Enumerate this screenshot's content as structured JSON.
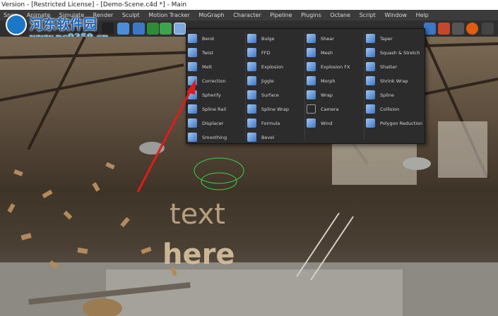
{
  "window": {
    "title": "Version - [Restricted License] - [Demo-Scene.c4d *] - Main"
  },
  "menubar": {
    "items": [
      "Snap",
      "Animate",
      "Simulate",
      "Render",
      "Sculpt",
      "Motion Tracker",
      "MoGraph",
      "Character",
      "Pipeline",
      "Plugins",
      "Octane",
      "Script",
      "Window",
      "Help"
    ]
  },
  "watermark": {
    "title": "河东软件园",
    "url": "www.pc0359.cn"
  },
  "scene_text": {
    "line1": "text",
    "line2": "here"
  },
  "deformer_menu": {
    "columns": [
      [
        {
          "label": "Bend",
          "icon": "bend-icon"
        },
        {
          "label": "Twist",
          "icon": "twist-icon"
        },
        {
          "label": "Melt",
          "icon": "melt-icon"
        },
        {
          "label": "Correction",
          "icon": "correction-icon"
        },
        {
          "label": "Spherify",
          "icon": "spherify-icon"
        },
        {
          "label": "Spline Rail",
          "icon": "spline-rail-icon"
        },
        {
          "label": "Displacer",
          "icon": "displacer-icon"
        },
        {
          "label": "Smoothing",
          "icon": "smoothing-icon"
        }
      ],
      [
        {
          "label": "Bulge",
          "icon": "bulge-icon"
        },
        {
          "label": "FFD",
          "icon": "ffd-icon"
        },
        {
          "label": "Explosion",
          "icon": "explosion-icon"
        },
        {
          "label": "Jiggle",
          "icon": "jiggle-icon"
        },
        {
          "label": "Surface",
          "icon": "surface-icon"
        },
        {
          "label": "Spline Wrap",
          "icon": "spline-wrap-icon"
        },
        {
          "label": "Formula",
          "icon": "formula-icon"
        },
        {
          "label": "Bevel",
          "icon": "bevel-icon"
        }
      ],
      [
        {
          "label": "Shear",
          "icon": "shear-icon"
        },
        {
          "label": "Mesh",
          "icon": "mesh-icon"
        },
        {
          "label": "Explosion FX",
          "icon": "explosion-fx-icon"
        },
        {
          "label": "Morph",
          "icon": "morph-icon"
        },
        {
          "label": "Wrap",
          "icon": "wrap-icon"
        },
        {
          "label": "Camera",
          "icon": "camera-icon"
        },
        {
          "label": "Wind",
          "icon": "wind-icon"
        }
      ],
      [
        {
          "label": "Taper",
          "icon": "taper-icon"
        },
        {
          "label": "Squash & Stretch",
          "icon": "squash-stretch-icon"
        },
        {
          "label": "Shatter",
          "icon": "shatter-icon"
        },
        {
          "label": "Shrink Wrap",
          "icon": "shrink-wrap-icon"
        },
        {
          "label": "Spline",
          "icon": "spline-icon"
        },
        {
          "label": "Collision",
          "icon": "collision-icon"
        },
        {
          "label": "Polygon Reduction",
          "icon": "polygon-reduction-icon"
        }
      ]
    ]
  },
  "colors": {
    "menu_bg": "#2c2c2c",
    "icon_blue": "#3d77c8",
    "arrow_red": "#e01b1b"
  }
}
